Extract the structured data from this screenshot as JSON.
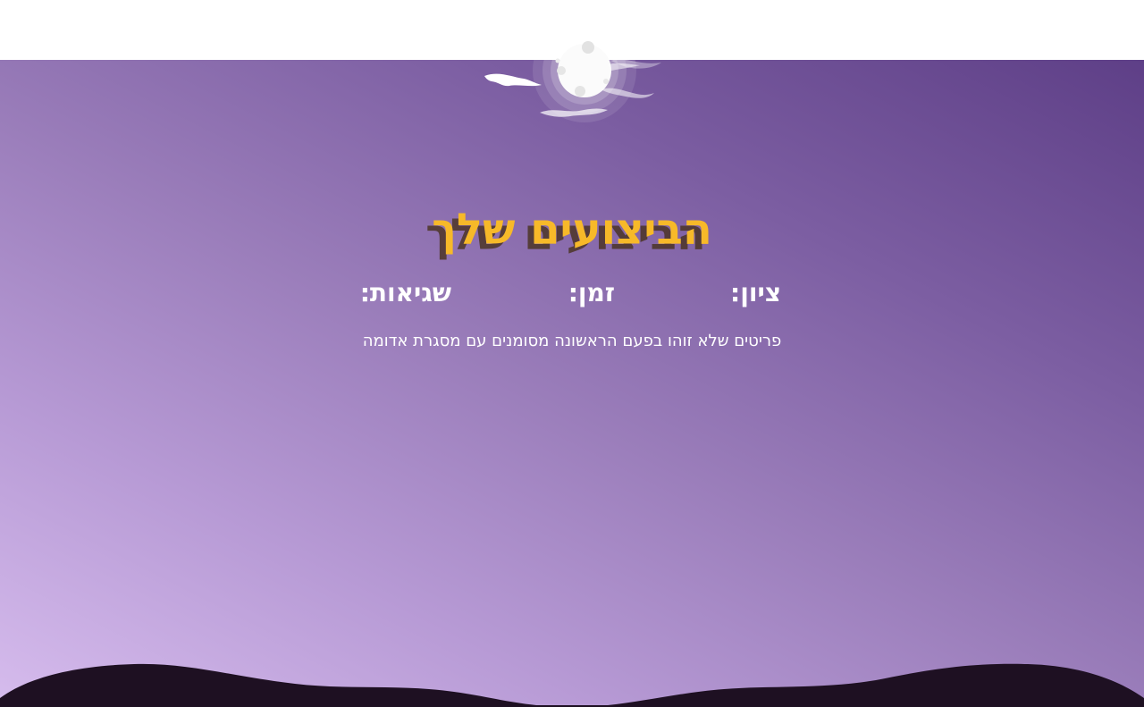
{
  "results": {
    "title": "הביצועים שלך",
    "score_label": "ציון:",
    "time_label": "זמן:",
    "errors_label": "שגיאות:",
    "hint": "פריטים שלא זוהו בפעם הראשונה מסומנים עם מסגרת אדומה"
  },
  "decor": {
    "moon_icon": "moon-with-clouds-icon",
    "hills_icon": "dark-hills-silhouette",
    "colors": {
      "title": "#f7b929",
      "title_shadow": "#46301a",
      "text": "#ffffff",
      "gradient_light": "#d6bced",
      "gradient_dark": "#5e3f87",
      "hills": "#1e1022"
    }
  }
}
